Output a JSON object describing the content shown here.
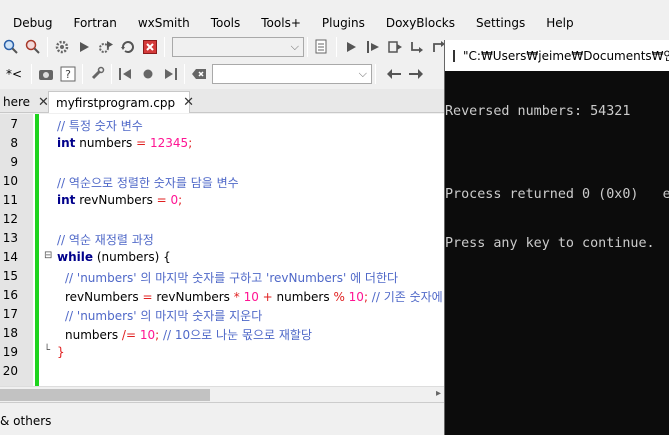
{
  "menu": [
    "Debug",
    "Fortran",
    "wxSmith",
    "Tools",
    "Tools+",
    "Plugins",
    "DoxyBlocks",
    "Settings",
    "Help"
  ],
  "toolbar2": {
    "left_text": "*<"
  },
  "tabs": [
    {
      "label": "here",
      "close": "✕"
    },
    {
      "label": "myfirstprogram.cpp",
      "close": "✕"
    }
  ],
  "editor": {
    "lines": [
      {
        "n": "7"
      },
      {
        "n": "8"
      },
      {
        "n": "9"
      },
      {
        "n": "10"
      },
      {
        "n": "11"
      },
      {
        "n": "12"
      },
      {
        "n": "13"
      },
      {
        "n": "14"
      },
      {
        "n": "15"
      },
      {
        "n": "16"
      },
      {
        "n": "17"
      },
      {
        "n": "18"
      },
      {
        "n": "19"
      },
      {
        "n": "20"
      }
    ],
    "code": {
      "l7": "// 특정 숫자 변수",
      "l8_kw": "int",
      "l8_a": " numbers ",
      "l8_op": "=",
      "l8_num": " 12345",
      "l8_end": ";",
      "l10": "// 역순으로 정렬한 숫자를 담을 변수",
      "l11_kw": "int",
      "l11_a": " revNumbers ",
      "l11_op": "=",
      "l11_num": " 0",
      "l11_end": ";",
      "l13": "// 역순 재정렬 과정",
      "l14_kw": "while",
      "l14_a": " (numbers) {",
      "l15": "// 'numbers' 의 마지막 숫자를 구하고 'revNumbers' 에 더한다",
      "l16_a": "revNumbers ",
      "l16_op1": "=",
      "l16_b": " revNumbers ",
      "l16_op2": "*",
      "l16_num1": " 10 ",
      "l16_op3": "+",
      "l16_c": " numbers ",
      "l16_op4": "%",
      "l16_num2": " 10",
      "l16_d": "; ",
      "l16_cmt": "// 기존 숫자에",
      "l17": "// 'numbers' 의 마지막 숫자를 지운다",
      "l18_a": "numbers ",
      "l18_op": "/=",
      "l18_num": " 10",
      "l18_b": "; ",
      "l18_cmt": "// 10으로 나눈 몫으로 재할당",
      "l19": "}"
    }
  },
  "bottom_panel": {
    "label": "& others"
  },
  "console": {
    "title": "\"C:₩Users₩jeime₩Documents₩언리",
    "lines": [
      "Reversed numbers: 54321",
      "",
      "Process returned 0 (0x0)   e",
      "Press any key to continue."
    ]
  }
}
